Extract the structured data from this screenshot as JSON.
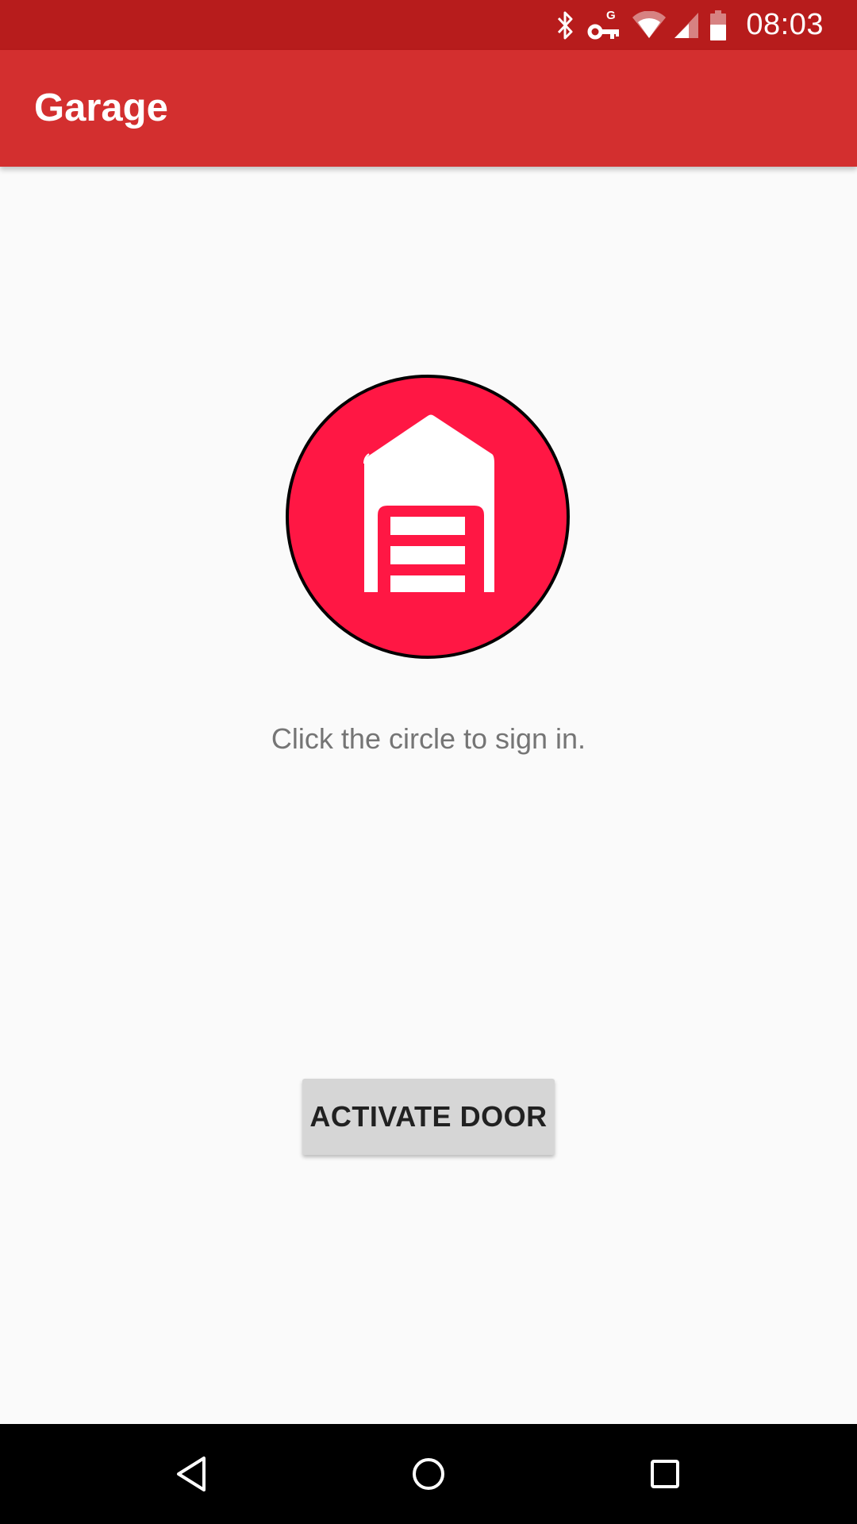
{
  "status_bar": {
    "time": "08:03",
    "icons": [
      "bluetooth-icon",
      "vpn-key-icon",
      "wifi-icon",
      "cell-signal-icon",
      "battery-icon"
    ]
  },
  "app_bar": {
    "title": "Garage"
  },
  "main": {
    "circle_icon": "garage-icon",
    "hint": "Click the circle to sign in.",
    "activate_button_label": "ACTIVATE DOOR"
  },
  "navigation_bar": {
    "buttons": [
      "back-icon",
      "home-icon",
      "recents-icon"
    ]
  },
  "colors": {
    "status_bar": "#b71c1c",
    "app_bar": "#d32f2f",
    "circle": "#ff1744",
    "background": "#fafafa",
    "button": "#d6d6d6"
  }
}
